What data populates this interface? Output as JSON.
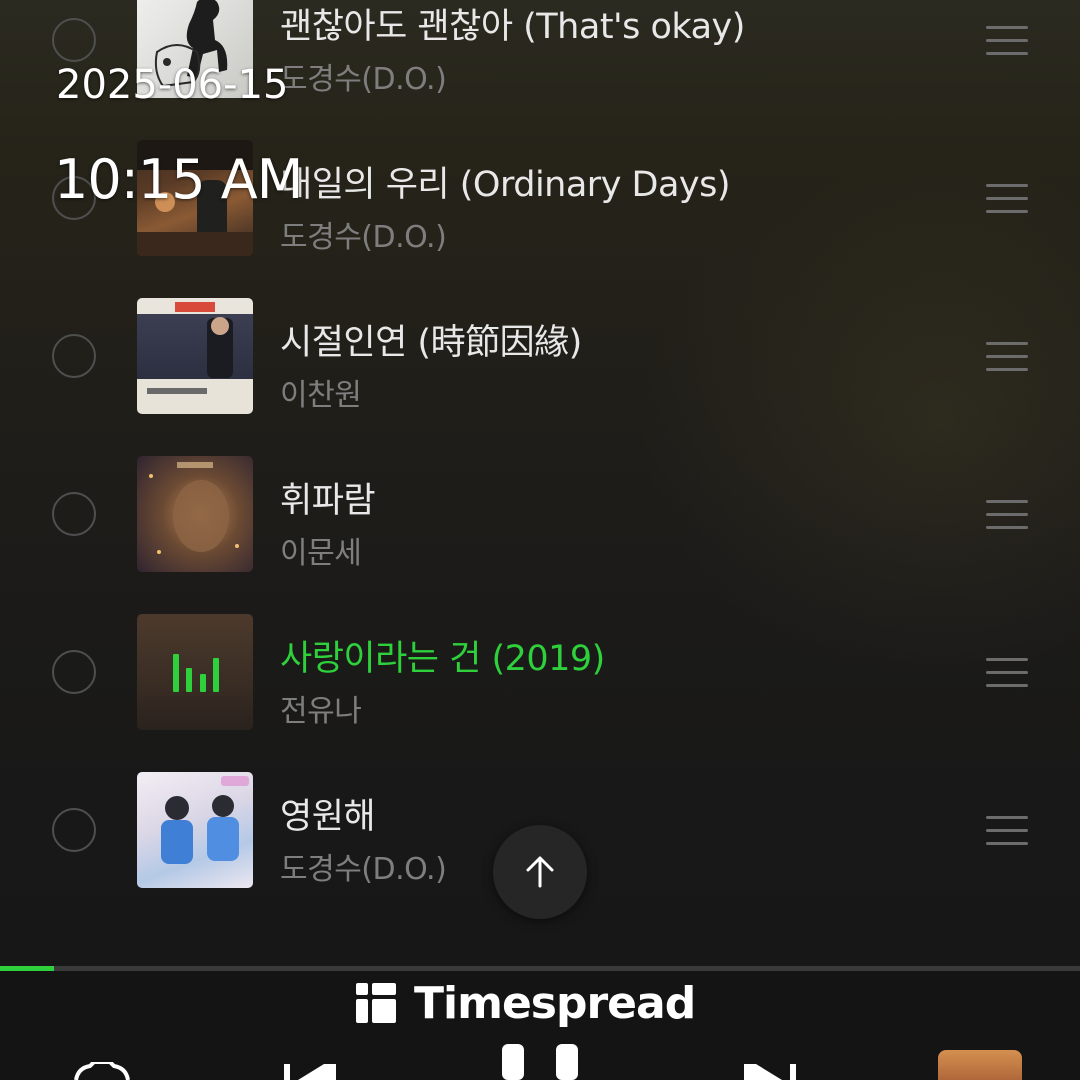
{
  "overlay": {
    "date": "2025-06-15",
    "time": "10:15 AM"
  },
  "playlist": {
    "songs": [
      {
        "title": "괜찮아도 괜찮아 (That's okay)",
        "artist": "도경수(D.O.)",
        "playing": false
      },
      {
        "title": "내일의 우리 (Ordinary Days)",
        "artist": "도경수(D.O.)",
        "playing": false
      },
      {
        "title": "시절인연 (時節因緣)",
        "artist": "이찬원",
        "playing": false
      },
      {
        "title": "휘파람",
        "artist": "이문세",
        "playing": false
      },
      {
        "title": "사랑이라는 건 (2019)",
        "artist": "전유나",
        "playing": true
      },
      {
        "title": "영원해",
        "artist": "도경수(D.O.)",
        "playing": false
      }
    ]
  },
  "player": {
    "progress": 0.05
  },
  "watermark": {
    "text": "Timespread"
  },
  "colors": {
    "accent": "#2ed03b",
    "background": "#161616",
    "title_text": "#e8e8e8",
    "artist_text": "#7e7e7e"
  },
  "icons": {
    "select": "circle-outline-icon",
    "drag": "drag-handle-icon",
    "scroll_top": "arrow-up-icon",
    "now_playing": "equalizer-icon",
    "settings": "gear-icon",
    "previous": "previous-track-icon",
    "pause": "pause-icon",
    "next": "next-track-icon",
    "logo": "timespread-logo-icon"
  }
}
